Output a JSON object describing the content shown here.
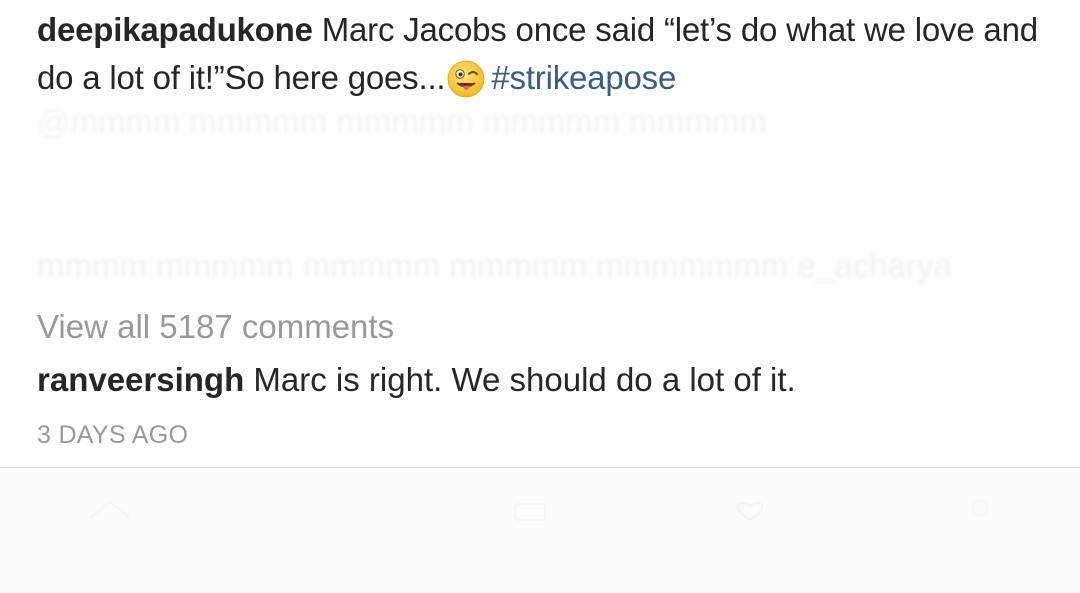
{
  "post": {
    "author": "deepikapadukone",
    "caption_text": "Marc Jacobs once said “let’s do what we love and do a lot of it!”So here goes...",
    "emoji": "winking-face-with-tongue",
    "hashtag": "#strikeapose"
  },
  "comments": {
    "view_all_label": "View all 5187 comments",
    "top_comment": {
      "username": "ranveersingh",
      "text": "Marc is right. We should do a lot of it."
    }
  },
  "timestamp": "3 DAYS AGO",
  "colors": {
    "text": "#262626",
    "muted": "#999999",
    "hashtag": "#385d86",
    "background": "#ffffff",
    "bottom_bar": "#fbfbfb"
  }
}
